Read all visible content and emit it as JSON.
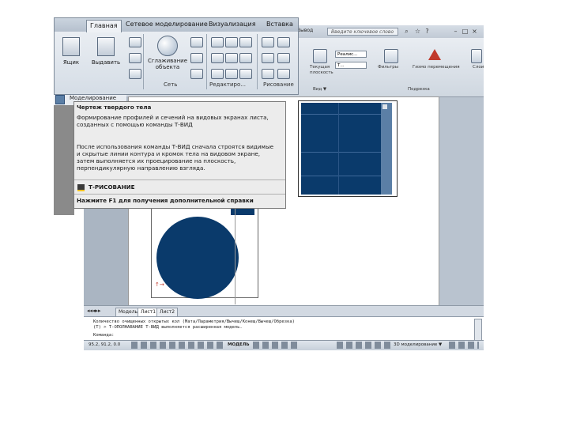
{
  "app": {
    "search_placeholder": "Введите ключевое слово",
    "window_buttons": [
      "–",
      "□",
      "×"
    ]
  },
  "ribbon_tabs": [
    "Главная",
    "Сетевое моделирование",
    "Визуализация",
    "Вставка"
  ],
  "ribbon_front": {
    "big_buttons": [
      "Ящик",
      "Выдавить",
      "Сглаживание объекта"
    ],
    "groups": [
      "Сеть",
      "Редактиро...",
      "Рисование"
    ]
  },
  "ribbon_back": {
    "tab_partial": "Вывод",
    "labels": [
      "Текущая плоскость",
      "Вид ▼",
      "Фильтры",
      "Гизмо перемещения",
      "Подрезка",
      "Слои"
    ],
    "combo_values": [
      "Реалис...",
      "Т..."
    ],
    "group_labels": [
      "Вид ▼",
      "Подрезка"
    ]
  },
  "tooltip": {
    "menu_item": "Моделирование",
    "title": "Чертеж твердого тела",
    "desc1": "Формирование профилей и сечений на видовых экранах листа, созданных с помощью команды Т-ВИД",
    "desc2": "После использования команды Т-ВИД сначала строятся видимые и скрытые линии контура и кромок тела на видовом экране, затем выполняется их проецирование на плоскость, перпендикулярную направлению взгляда.",
    "command": "Т-РИСОВАНИЕ",
    "help": "Нажмите F1 для получения дополнительной справки"
  },
  "layout_tabs": [
    "Модель",
    "Лист1",
    "Лист2"
  ],
  "command_line": {
    "line1": "Количество очищенных открытых кол (Мата/Параметрия/Вычеш/Конеш/Вычеш/Обрезка)",
    "line2": "(Т) > Т-ОПОЛНАВАНИЕ Т-ВИД выполняется расширенная модель.",
    "prompt": "Команда:"
  },
  "status": {
    "coords": "95.2, 91.2, 0.0",
    "mode": "МОДЕЛЬ",
    "workspace": "3D моделирование ▼"
  },
  "colors": {
    "navy": "#0a3a6b",
    "ribbon": "#d5dde6"
  }
}
